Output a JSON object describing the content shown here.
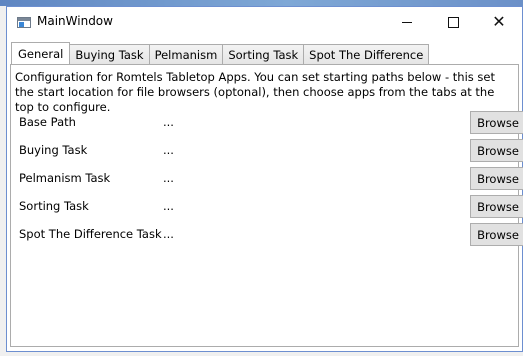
{
  "window": {
    "title": "MainWindow",
    "controls": {
      "minimize": "minimize",
      "maximize": "maximize",
      "close": "close"
    }
  },
  "tabs": [
    {
      "label": "General",
      "active": true
    },
    {
      "label": "Buying Task",
      "active": false
    },
    {
      "label": "Pelmanism",
      "active": false
    },
    {
      "label": "Sorting Task",
      "active": false
    },
    {
      "label": "Spot The Difference",
      "active": false
    }
  ],
  "general": {
    "description": "Configuration for Romtels Tabletop Apps. You can set starting paths below - this set the start location for file browsers (optonal), then choose apps from the tabs at the top to configure.",
    "rows": [
      {
        "label": "Base Path",
        "value": "...",
        "button": "Browse"
      },
      {
        "label": "Buying Task",
        "value": "...",
        "button": "Browse"
      },
      {
        "label": "Pelmanism Task",
        "value": "...",
        "button": "Browse"
      },
      {
        "label": "Sorting Task",
        "value": "...",
        "button": "Browse"
      },
      {
        "label": "Spot The Difference Task",
        "value": "...",
        "button": "Browse"
      }
    ]
  },
  "colors": {
    "accent": "#6d8fd0",
    "button_face": "#e1e1e1",
    "button_border": "#adadad"
  }
}
